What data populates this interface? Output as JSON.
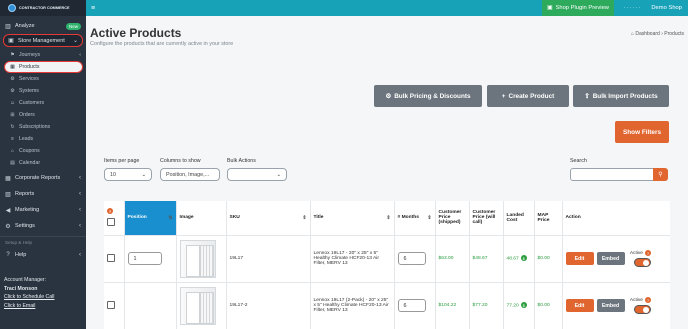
{
  "brand": {
    "logo_text": "CONTRACTOR COMMERCE"
  },
  "sidebar": {
    "analyze": "Analyze",
    "analyze_badge": "New",
    "store_management": "Store Management",
    "sub_items": [
      "Journeys",
      "Products",
      "Services",
      "Systems",
      "Customers",
      "Orders",
      "Subscriptions",
      "Leads",
      "Coupons",
      "Calendar"
    ],
    "corporate_reports": "Corporate Reports",
    "reports": "Reports",
    "marketing": "Marketing",
    "settings": "Settings",
    "setup_help": "Setup & Help",
    "help": "Help",
    "account_manager_label": "Account Manager:",
    "account_manager_name": "Traci Monson",
    "schedule_call": "Click to Schedule Call",
    "email": "Click to Email"
  },
  "topbar": {
    "plugin_preview": "Shop Plugin Preview",
    "user_name": "Demo Shop"
  },
  "header": {
    "title": "Active Products",
    "subtitle": "Configure the products that are currently active in your store",
    "breadcrumb_home": "Dashboard",
    "breadcrumb_current": "Products"
  },
  "actions": {
    "bulk_pricing": "Bulk Pricing & Discounts",
    "create_product": "Create Product",
    "bulk_import": "Bulk Import Products",
    "show_filters": "Show Filters"
  },
  "controls": {
    "items_per_page_label": "Items per page",
    "items_per_page_value": "10",
    "columns_label": "Columns to show",
    "columns_value": "Position, Image,...",
    "bulk_actions_label": "Bulk Actions",
    "bulk_actions_value": "",
    "search_label": "Search",
    "search_value": ""
  },
  "table": {
    "columns": [
      "Position",
      "Image",
      "SKU",
      "Title",
      "# Months",
      "Customer Price (shipped)",
      "Customer Price (will call)",
      "Landed Cost",
      "MAP Price",
      "Action"
    ],
    "rows": [
      {
        "position": "1",
        "sku": "19L17",
        "title": "Lennox 19L17 - 20\" x 25\" x 5\" Healthy Climate HCF20-13 Air Filter, MERV 13",
        "months": "6",
        "price_shipped": "$63.00",
        "price_will_call": "$48.67",
        "landed_cost": "48.67",
        "map_price": "$0.00",
        "edit": "Edit",
        "embed": "Embed",
        "active": "Active"
      },
      {
        "position": "",
        "sku": "19L17-2",
        "title": "Lennox 19L17 (2-Pack) - 20\" x 25\" x 5\" Healthy Climate HCF20-13 Air Filter, MERV 13",
        "months": "6",
        "price_shipped": "$104.22",
        "price_will_call": "$77.20",
        "landed_cost": "77.20",
        "map_price": "$0.00",
        "edit": "Edit",
        "embed": "Embed",
        "active": "Active"
      }
    ]
  },
  "colors": {
    "accent_teal": "#17a2b8",
    "orange": "#e0652f",
    "green": "#2eaa5d",
    "sidebar": "#2a3440"
  }
}
